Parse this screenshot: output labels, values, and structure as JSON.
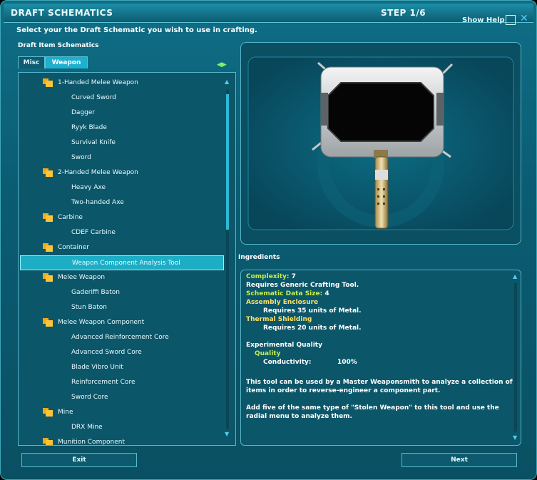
{
  "window": {
    "title": "DRAFT SCHEMATICS",
    "step": "STEP 1/6",
    "show_help": "Show Help",
    "close_glyph": "✕"
  },
  "instruction": "Select your the Draft Schematic you wish to use in crafting.",
  "draft_label": "Draft Item Schematics",
  "tabs": {
    "misc": "Misc",
    "weapon": "Weapon",
    "active": "Weapon"
  },
  "tree": [
    {
      "label": "1-Handed Melee Weapon",
      "type": "category"
    },
    {
      "label": "Curved Sword",
      "type": "item"
    },
    {
      "label": "Dagger",
      "type": "item"
    },
    {
      "label": "Ryyk Blade",
      "type": "item"
    },
    {
      "label": "Survival Knife",
      "type": "item"
    },
    {
      "label": "Sword",
      "type": "item"
    },
    {
      "label": "2-Handed Melee Weapon",
      "type": "category"
    },
    {
      "label": "Heavy Axe",
      "type": "item"
    },
    {
      "label": "Two-handed Axe",
      "type": "item"
    },
    {
      "label": "Carbine",
      "type": "category"
    },
    {
      "label": "CDEF Carbine",
      "type": "item"
    },
    {
      "label": "Container",
      "type": "category"
    },
    {
      "label": "Weapon Component Analysis Tool",
      "type": "item",
      "selected": true
    },
    {
      "label": "Melee Weapon",
      "type": "category"
    },
    {
      "label": "Gaderiffi Baton",
      "type": "item"
    },
    {
      "label": "Stun Baton",
      "type": "item"
    },
    {
      "label": "Melee Weapon Component",
      "type": "category"
    },
    {
      "label": "Advanced Reinforcement Core",
      "type": "item"
    },
    {
      "label": "Advanced Sword Core",
      "type": "item"
    },
    {
      "label": "Blade Vibro Unit",
      "type": "item"
    },
    {
      "label": "Reinforcement Core",
      "type": "item"
    },
    {
      "label": "Sword Core",
      "type": "item"
    },
    {
      "label": "Mine",
      "type": "category"
    },
    {
      "label": "DRX Mine",
      "type": "item"
    },
    {
      "label": "Munition Component",
      "type": "category"
    }
  ],
  "ingredients_title": "Ingredients",
  "info": {
    "complexity_label": "Complexity:",
    "complexity_value": "7",
    "requires_tool": "Requires Generic Crafting Tool.",
    "data_size_label": "Schematic Data Size:",
    "data_size_value": "4",
    "assembly_label": "Assembly Enclosure",
    "assembly_req": "Requires 35 units of Metal.",
    "thermal_label": "Thermal Shielding",
    "thermal_req": "Requires 20 units of Metal.",
    "exp_quality": "Experimental Quality",
    "quality": "Quality",
    "conductivity_label": "Conductivity:",
    "conductivity_value": "100%",
    "desc1a": "This tool can be used by a Master Weaponsmith to analyze a collection of",
    "desc1b": "items in order to reverse-engineer a component part.",
    "desc2a": "Add five of the same type of \"Stolen Weapon\" to this tool and use the",
    "desc2b": "radial menu to analyze them."
  },
  "buttons": {
    "exit": "Exit",
    "next": "Next"
  },
  "colors": {
    "accent": "#1daec6",
    "label_green": "#c4f04a",
    "label_yellow": "#ffe066",
    "folder": "#f3a913"
  }
}
